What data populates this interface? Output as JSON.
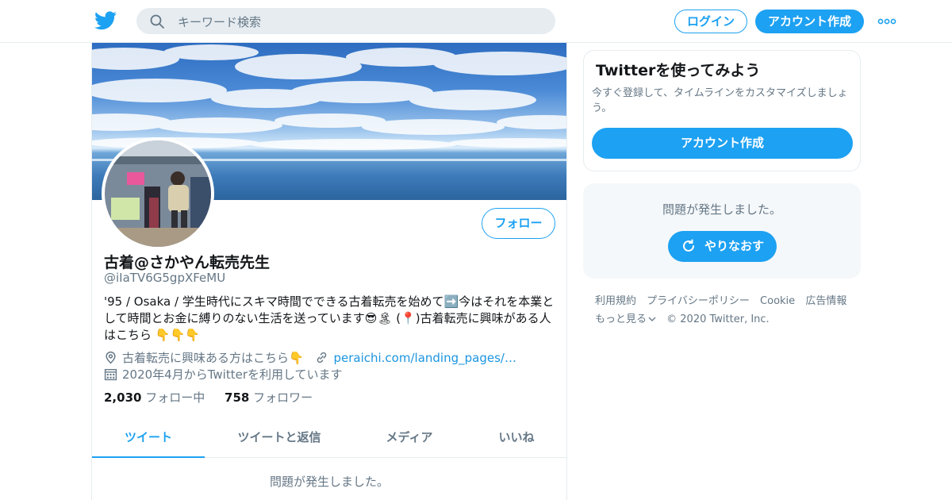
{
  "header": {
    "search_placeholder": "キーワード検索",
    "login_label": "ログイン",
    "signup_label": "アカウント作成"
  },
  "profile": {
    "name": "古着@さかやん転売先生",
    "handle": "@iIaTV6G5gpXFeMU",
    "bio": "'95 / Osaka / 学生時代にスキマ時間でできる古着転売を始めて➡️今はそれを本業として時間とお金に縛りのない生活を送っています😎🏝 (📍)古着転売に興味がある人はこちら 👇👇👇",
    "location": "古着転売に興味ある方はこちら👇",
    "url": "peraichi.com/landing_pages/…",
    "joined": "2020年4月からTwitterを利用しています",
    "following_count": "2,030",
    "following_label": "フォロー中",
    "followers_count": "758",
    "followers_label": "フォロワー",
    "follow_button": "フォロー"
  },
  "tabs": [
    "ツイート",
    "ツイートと返信",
    "メディア",
    "いいね"
  ],
  "active_tab": "ツイート",
  "timeline_error": "問題が発生しました。",
  "signup_card": {
    "title": "Twitterを使ってみよう",
    "description": "今すぐ登録して、タイムラインをカスタマイズしましょう。",
    "button": "アカウント作成"
  },
  "error_card": {
    "message": "問題が発生しました。",
    "retry_button": "やりなおす"
  },
  "footer": {
    "links": [
      "利用規約",
      "プライバシーポリシー",
      "Cookie",
      "広告情報",
      "もっと見る"
    ],
    "copyright": "© 2020 Twitter, Inc."
  },
  "colors": {
    "accent": "#1da1f2",
    "text_secondary": "#657786",
    "border": "#e6ecf0"
  },
  "icons": [
    "twitter-logo-icon",
    "search-icon",
    "more-dots-icon",
    "location-icon",
    "link-icon",
    "calendar-icon",
    "refresh-icon",
    "chevron-down-icon"
  ]
}
